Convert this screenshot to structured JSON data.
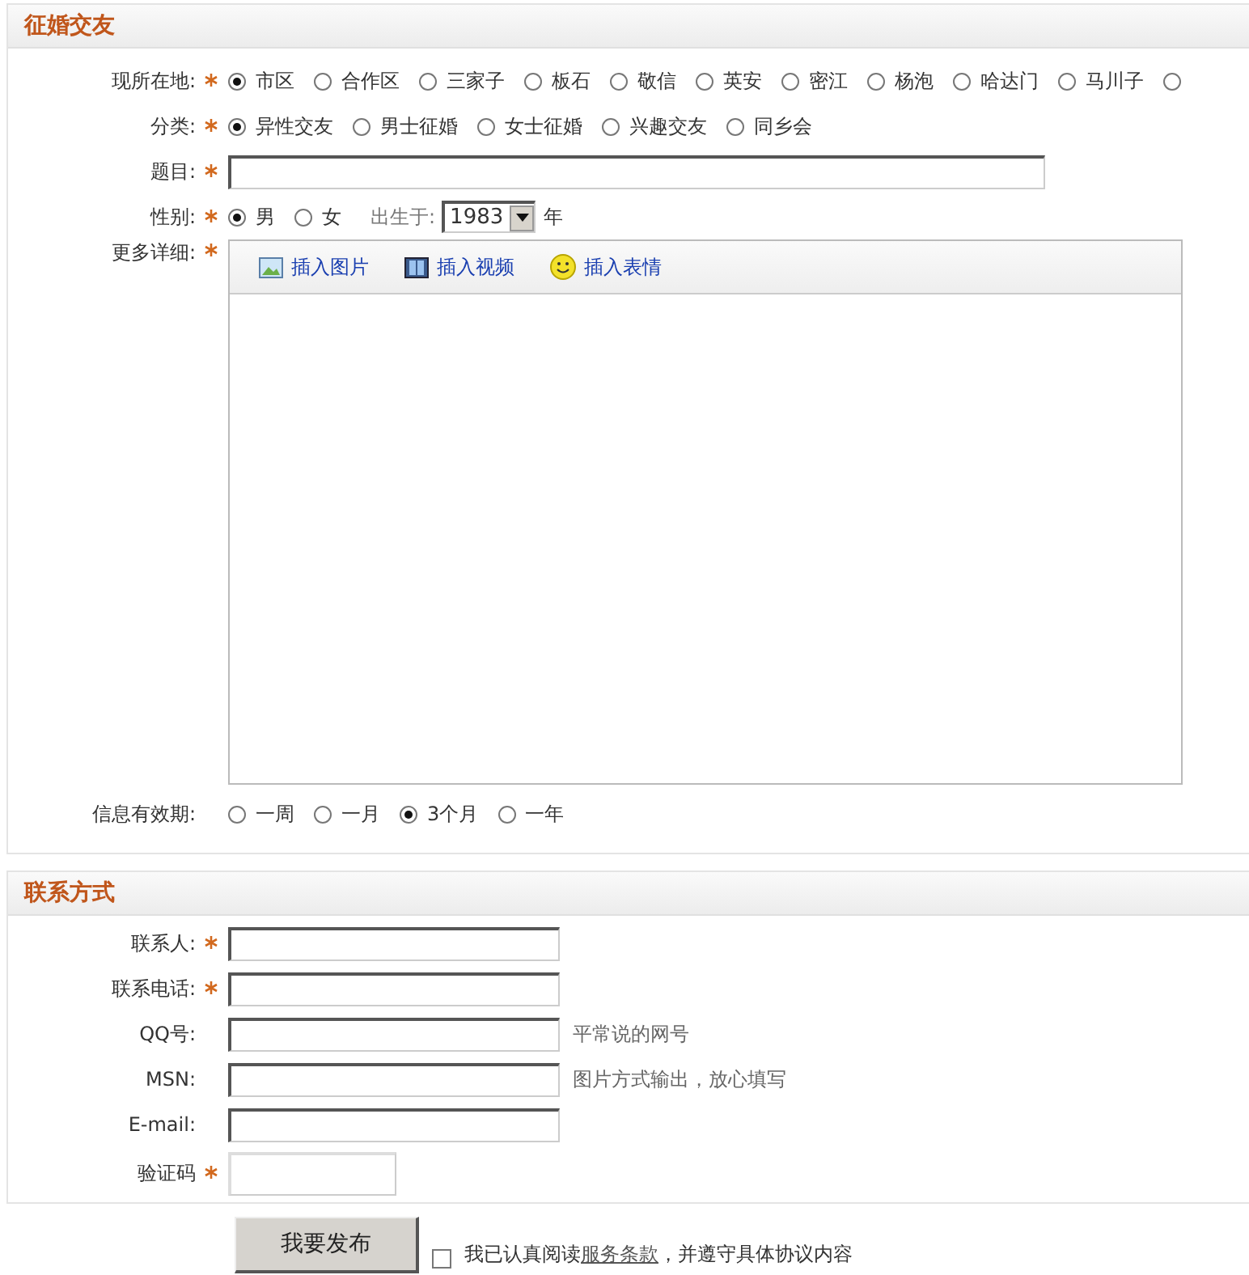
{
  "post_section": {
    "title": "征婚交友",
    "location": {
      "label": "现所在地:",
      "required": true,
      "options": [
        {
          "label": "市区",
          "selected": true
        },
        {
          "label": "合作区",
          "selected": false
        },
        {
          "label": "三家子",
          "selected": false
        },
        {
          "label": "板石",
          "selected": false
        },
        {
          "label": "敬信",
          "selected": false
        },
        {
          "label": "英安",
          "selected": false
        },
        {
          "label": "密江",
          "selected": false
        },
        {
          "label": "杨泡",
          "selected": false
        },
        {
          "label": "哈达门",
          "selected": false
        },
        {
          "label": "马川子",
          "selected": false
        },
        {
          "selected": false
        }
      ]
    },
    "category": {
      "label": "分类:",
      "required": true,
      "options": [
        {
          "label": "异性交友",
          "selected": true
        },
        {
          "label": "男士征婚",
          "selected": false
        },
        {
          "label": "女士征婚",
          "selected": false
        },
        {
          "label": "兴趣交友",
          "selected": false
        },
        {
          "label": "同乡会",
          "selected": false
        }
      ]
    },
    "subject": {
      "label": "题目:",
      "required": true
    },
    "gender": {
      "label": "性别:",
      "required": true,
      "options": [
        {
          "label": "男",
          "selected": true
        },
        {
          "label": "女",
          "selected": false
        }
      ],
      "birth_label": "出生于:",
      "birth_year": "1983",
      "year_unit": "年"
    },
    "details": {
      "label": "更多详细:",
      "required": true,
      "toolbar": [
        {
          "kind": "image",
          "label": "插入图片"
        },
        {
          "kind": "video",
          "label": "插入视频"
        },
        {
          "kind": "emoticon",
          "label": "插入表情"
        }
      ]
    },
    "validity": {
      "label": "信息有效期:",
      "required": false,
      "options": [
        {
          "label": "一周",
          "selected": false
        },
        {
          "label": "一月",
          "selected": false
        },
        {
          "label": "3个月",
          "selected": true
        },
        {
          "label": "一年",
          "selected": false
        }
      ]
    }
  },
  "contact_section": {
    "title": "联系方式",
    "fields": [
      {
        "kind": "text",
        "label": "联系人:",
        "required": true
      },
      {
        "kind": "text",
        "label": "联系电话:",
        "required": true
      },
      {
        "kind": "text",
        "label": "QQ号:",
        "required": false,
        "hint": "平常说的网号"
      },
      {
        "kind": "text",
        "label": "MSN:",
        "required": false,
        "hint": "图片方式输出，放心填写"
      },
      {
        "kind": "text",
        "label": "E-mail:",
        "required": false
      },
      {
        "kind": "captcha",
        "label": "验证码",
        "required": true
      }
    ]
  },
  "submit": {
    "button": "我要发布",
    "agree": {
      "checked": false,
      "text_before": "我已认真阅读",
      "link": "服务条款",
      "text_after": "，并遵守具体协议内容"
    }
  }
}
